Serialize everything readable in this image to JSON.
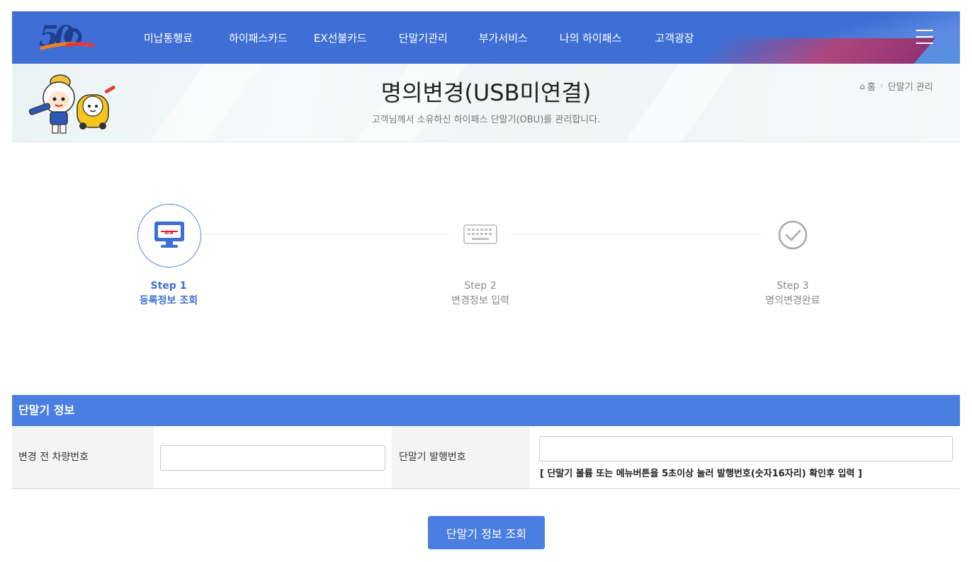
{
  "nav": {
    "logo_text": "50",
    "items": [
      {
        "label": "미납통행료"
      },
      {
        "label": "하이패스카드"
      },
      {
        "label": "EX선불카드"
      },
      {
        "label": "단말기관리"
      },
      {
        "label": "부가서비스"
      },
      {
        "label": "나의 하이패스"
      },
      {
        "label": "고객광장"
      }
    ]
  },
  "banner": {
    "title": "명의변경(USB미연결)",
    "subtitle": "고객님께서 소유하신 하이패스 단말기(OBU)를 관리합니다.",
    "breadcrumb": {
      "home": "홈",
      "current": "단말기 관리"
    }
  },
  "steps": [
    {
      "num": "Step 1",
      "label": "등록정보 조회",
      "icon": "monitor-ex-icon",
      "active": true
    },
    {
      "num": "Step 2",
      "label": "변경정보 입력",
      "icon": "keyboard-icon",
      "active": false
    },
    {
      "num": "Step 3",
      "label": "명의변경완료",
      "icon": "check-circle-icon",
      "active": false
    }
  ],
  "form": {
    "section_title": "단말기 정보",
    "field1_label": "변경 전 차량번호",
    "field1_value": "",
    "field2_label": "단말기 발행번호",
    "field2_value": "",
    "field2_hint": "[ 단말기 볼륨 또는 메뉴버튼을 5초이상 눌러 발행번호(숫자16자리) 확인후 입력 ]"
  },
  "submit_label": "단말기 정보 조회",
  "colors": {
    "nav_bg": "#3f6fd4",
    "accent": "#4a7ee0",
    "active_step": "#3f6fd4",
    "inactive_step": "#8a8a8a"
  }
}
